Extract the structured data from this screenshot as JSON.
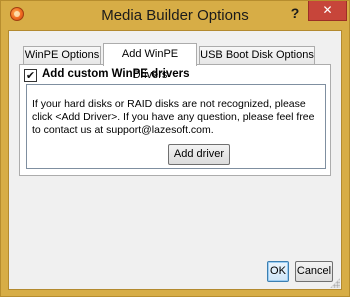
{
  "window": {
    "title": "Media Builder Options",
    "help_label": "?",
    "close_label": "✕",
    "frame_color": "#d7ad46",
    "close_color": "#c7453a"
  },
  "tabs": [
    {
      "label": "WinPE Options",
      "active": false
    },
    {
      "label": "Add WinPE Drivers",
      "active": true
    },
    {
      "label": "USB Boot Disk Options",
      "active": false
    }
  ],
  "drivers_panel": {
    "checkbox_label": "Add custom WinPE drivers",
    "checkbox_checked": true,
    "checkmark": "✔",
    "info_text": "If your hard disks or RAID disks are not recognized, please click <Add Driver>. If you have any question, please feel free to contact us at support@lazesoft.com.",
    "add_driver_label": "Add driver"
  },
  "footer": {
    "ok_label": "OK",
    "cancel_label": "Cancel"
  }
}
